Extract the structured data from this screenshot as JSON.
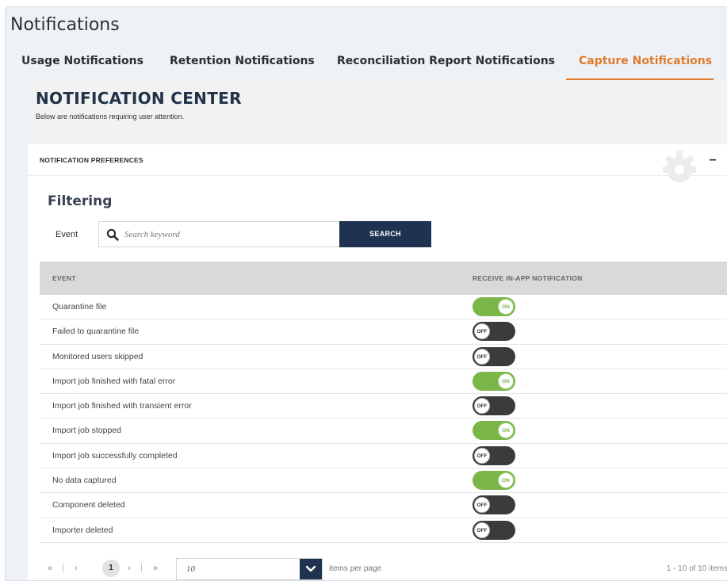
{
  "app": {
    "title": "Notifications"
  },
  "tabs": [
    {
      "label": "Usage Notifications",
      "active": false
    },
    {
      "label": "Retention Notifications",
      "active": false
    },
    {
      "label": "Reconciliation Report Notifications",
      "active": false
    },
    {
      "label": "Capture Notifications",
      "active": true
    }
  ],
  "center": {
    "title": "NOTIFICATION CENTER",
    "subtitle": "Below are notifications requiring user attention."
  },
  "preferences": {
    "title": "NOTIFICATION PREFERENCES",
    "collapse_label": "–"
  },
  "filtering": {
    "title": "Filtering",
    "event_label": "Event",
    "placeholder": "Search keyword",
    "search_button": "SEARCH"
  },
  "table": {
    "columns": [
      "EVENT",
      "RECEIVE IN-APP NOTIFICATION"
    ],
    "rows": [
      {
        "event": "Quarantine file",
        "state": "ON"
      },
      {
        "event": "Failed to quarantine file",
        "state": "OFF"
      },
      {
        "event": "Monitored users skipped",
        "state": "OFF"
      },
      {
        "event": "Import job finished with fatal error",
        "state": "ON"
      },
      {
        "event": "Import job finished with transient error",
        "state": "OFF"
      },
      {
        "event": "Import job stopped",
        "state": "ON"
      },
      {
        "event": "Import job successfully completed",
        "state": "OFF"
      },
      {
        "event": "No data captured",
        "state": "ON"
      },
      {
        "event": "Component deleted",
        "state": "OFF"
      },
      {
        "event": "Importer deleted",
        "state": "OFF"
      }
    ]
  },
  "pagination": {
    "first": "«",
    "prev": "‹",
    "current_page": "1",
    "next": "›",
    "last": "»",
    "per_page_value": "10",
    "per_page_label": "items per page",
    "info": "1 - 10 of 10 items"
  },
  "colors": {
    "accent": "#e07b2c",
    "navy": "#1f3350",
    "toggle_on": "#7ab648",
    "toggle_off": "#3b3b3b"
  },
  "icons": {
    "search": "search-icon",
    "gear": "gear-icon",
    "dropdown": "chevron-down-icon"
  }
}
